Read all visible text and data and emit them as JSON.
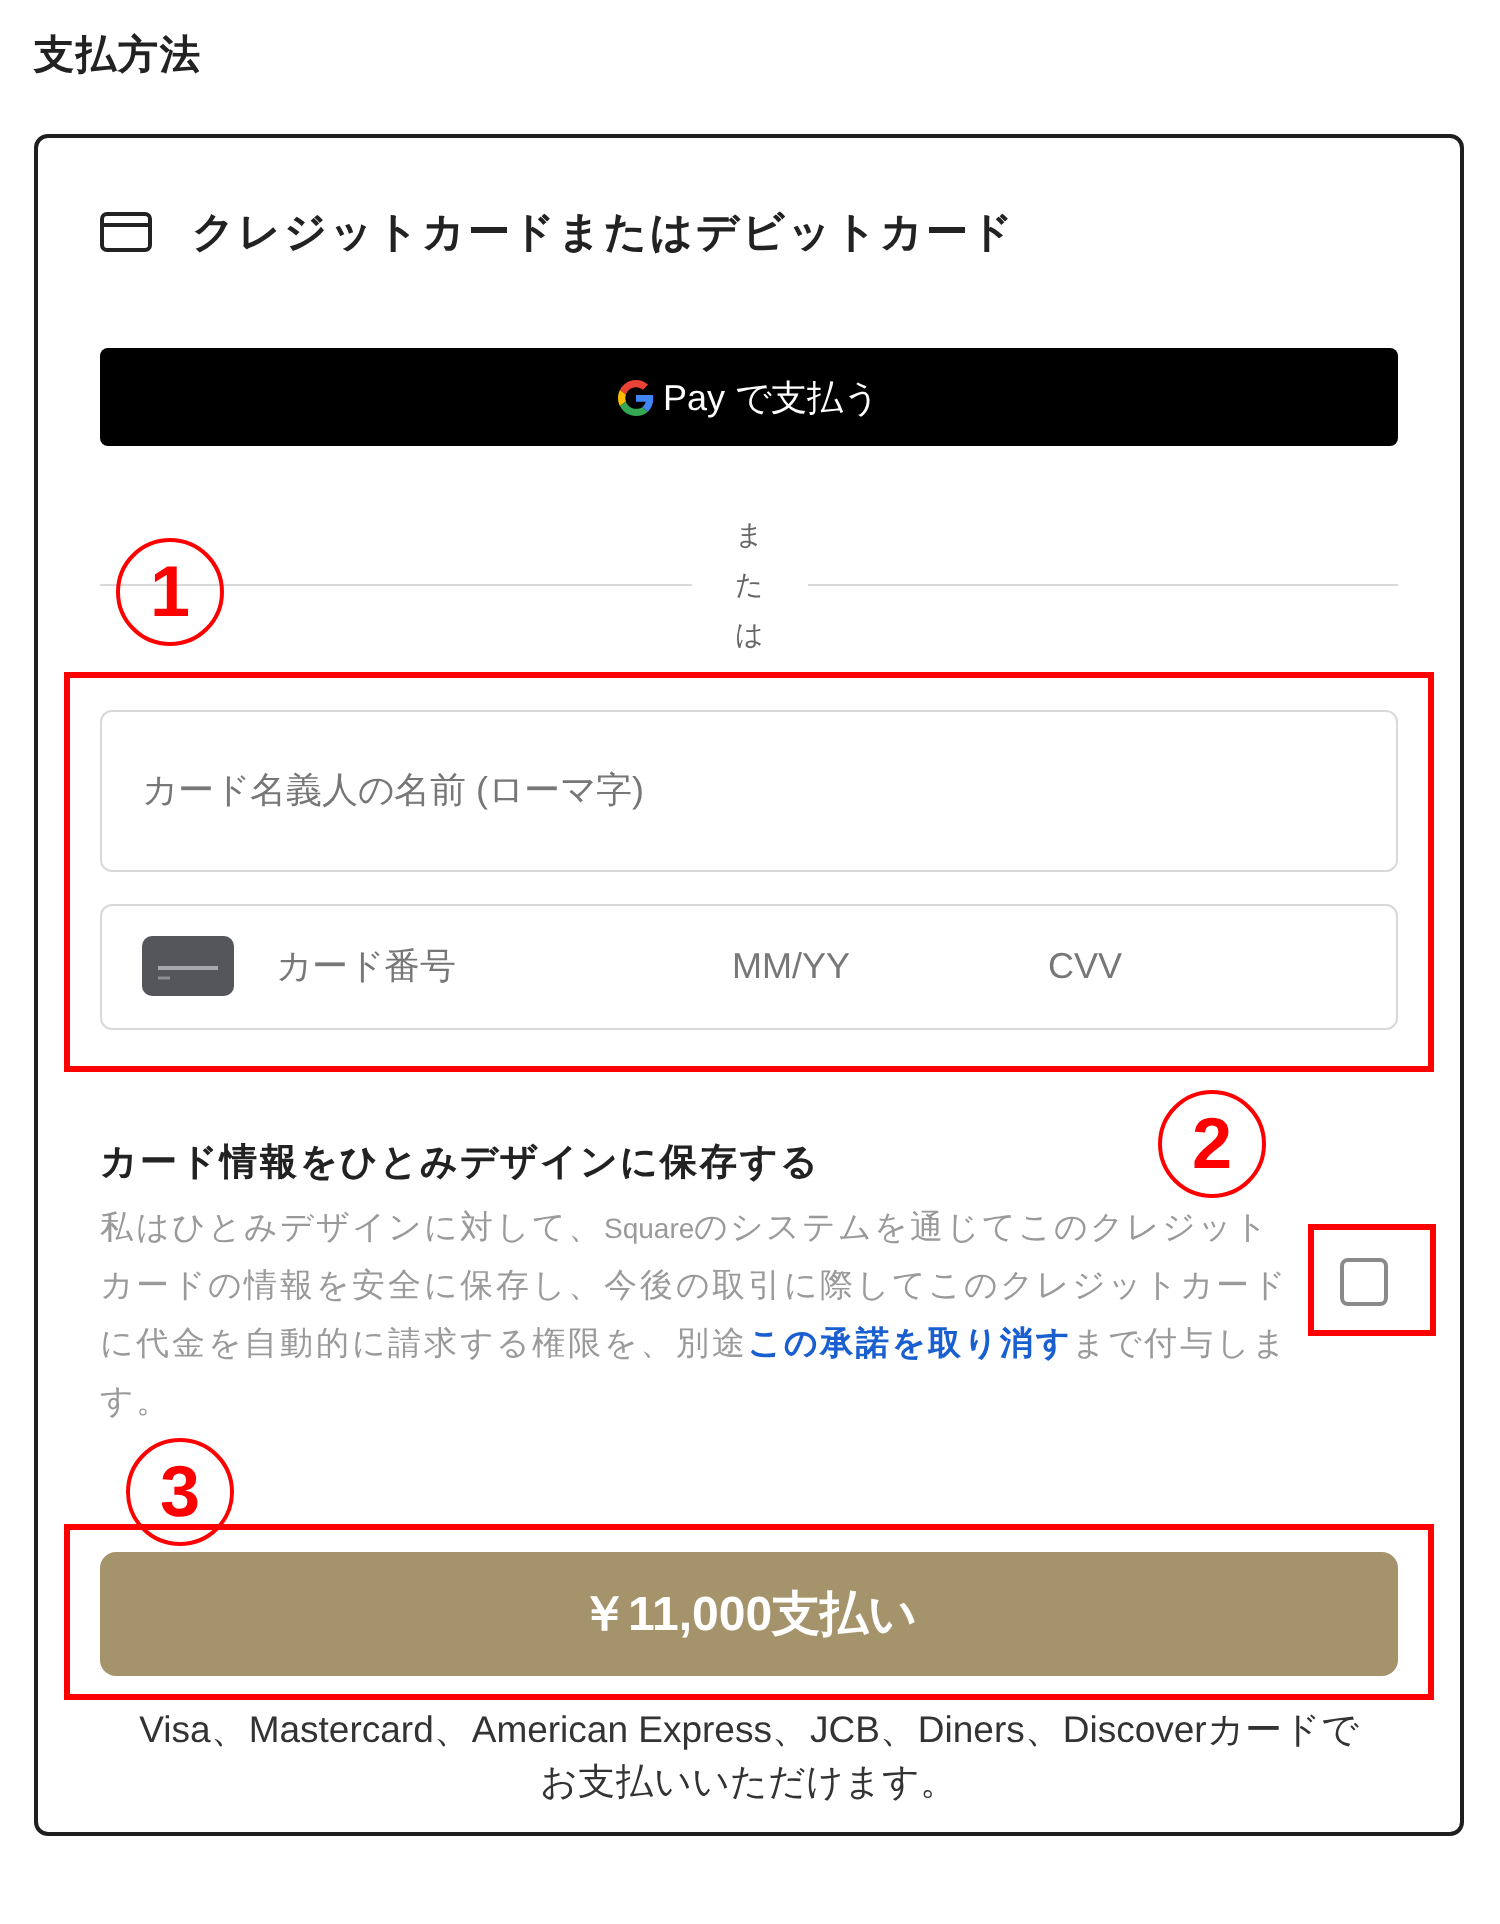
{
  "section_title": "支払方法",
  "card": {
    "header": {
      "title": "クレジットカードまたはデビットカード"
    },
    "wallet_button": {
      "label": "Pay で支払う"
    },
    "divider": {
      "label": "または"
    },
    "name_field": {
      "placeholder": "カード名義人の名前 (ローマ字)"
    },
    "card_field": {
      "number_placeholder": "カード番号",
      "expiry_placeholder": "MM/YY",
      "cvv_placeholder": "CVV"
    },
    "save_card": {
      "title": "カード情報をひとみデザインに保存する",
      "description": "私はひとみデザインに対して、Squareのシステムを通じてこのクレジットカードの情報を安全に保存し、今後の取引に際してこのクレジットカードに代金を自動的に請求する権限を、別途",
      "link": "この承諾を取り消す",
      "description_end": "まで付与します。",
      "checked": false
    },
    "pay_button": {
      "label": "￥11,000支払い"
    },
    "accepted_cards_note": "Visa、Mastercard、American Express、JCB、Diners、Discoverカードでお支払いいただけます。"
  },
  "annotations": [
    {
      "number": "1"
    },
    {
      "number": "2"
    },
    {
      "number": "3"
    }
  ]
}
